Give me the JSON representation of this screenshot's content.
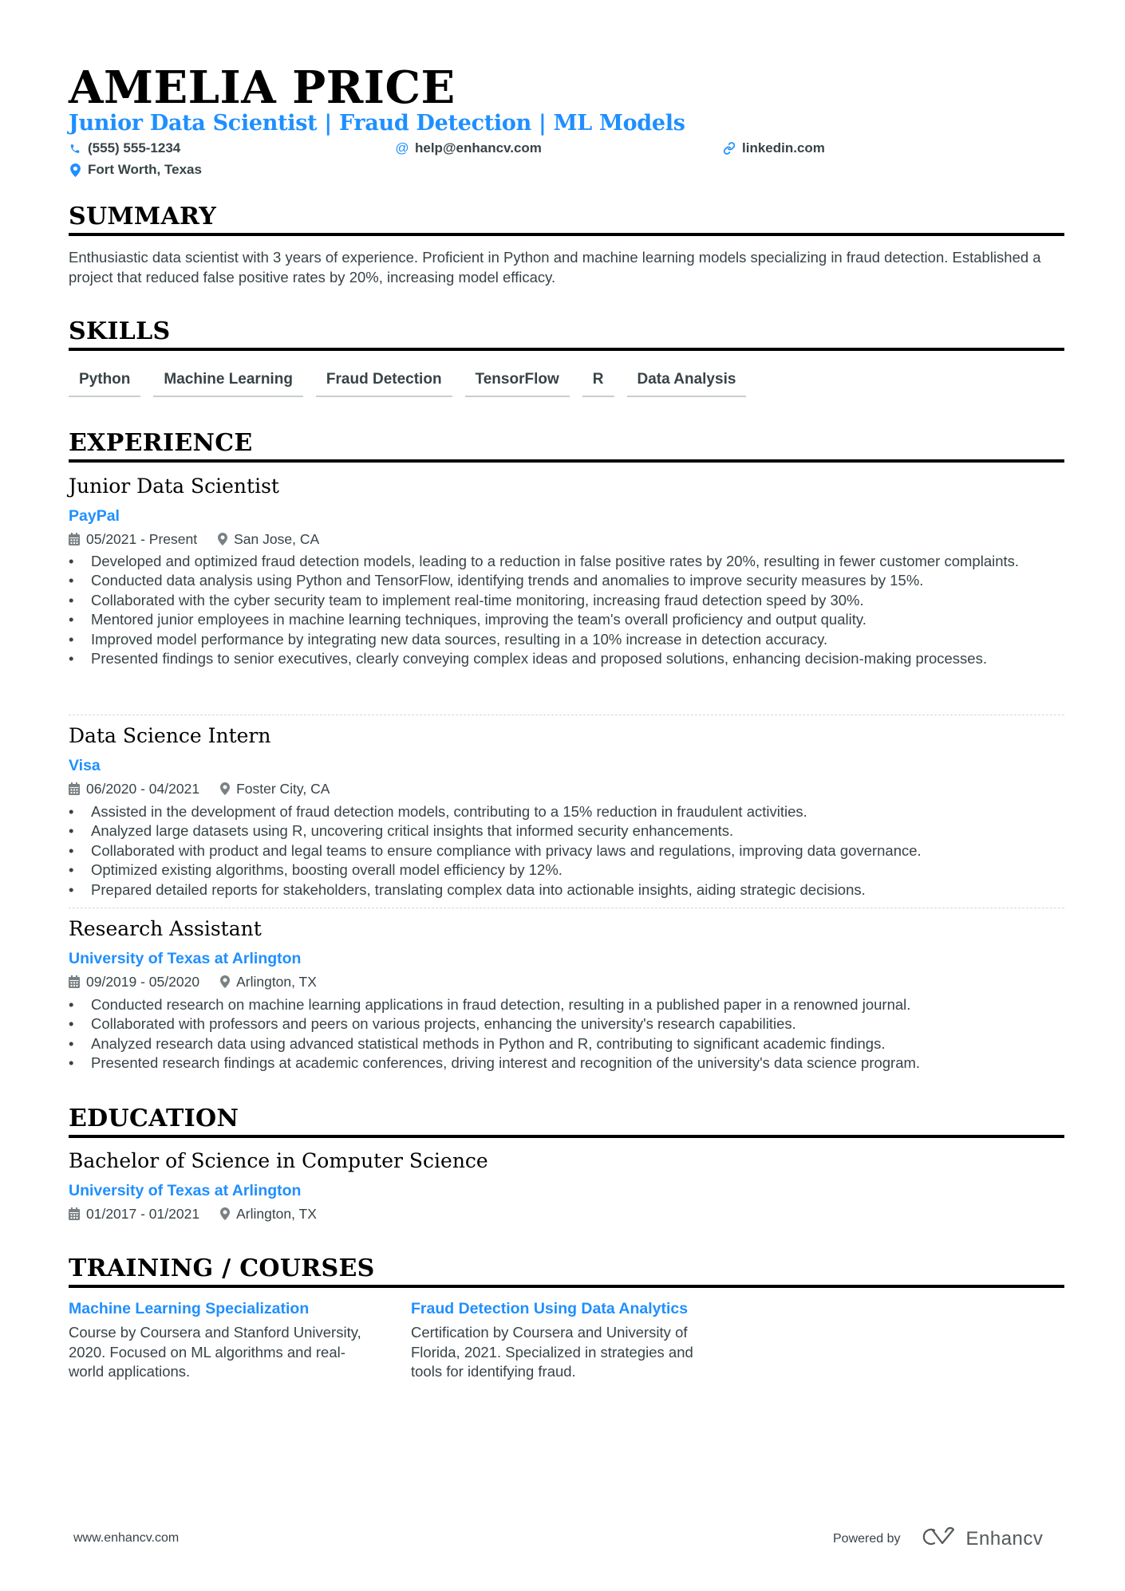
{
  "header": {
    "name": "AMELIA PRICE",
    "headline": "Junior Data Scientist | Fraud Detection | ML Models",
    "contacts": {
      "phone": "(555) 555-1234",
      "email": "help@enhancv.com",
      "link": "linkedin.com",
      "location": "Fort Worth, Texas"
    }
  },
  "summary": {
    "title": "SUMMARY",
    "text": "Enthusiastic data scientist with 3 years of experience. Proficient in Python and machine learning models specializing in fraud detection. Established a project that reduced false positive rates by 20%, increasing model efficacy."
  },
  "skills": {
    "title": "SKILLS",
    "items": [
      "Python",
      "Machine Learning",
      "Fraud Detection",
      "TensorFlow",
      "R",
      "Data Analysis"
    ]
  },
  "experience": {
    "title": "EXPERIENCE",
    "jobs": [
      {
        "title": "Junior Data Scientist",
        "company": "PayPal",
        "dates": "05/2021 - Present",
        "location": "San Jose, CA",
        "bullets": [
          "Developed and optimized fraud detection models, leading to a reduction in false positive rates by 20%, resulting in fewer customer complaints.",
          "Conducted data analysis using Python and TensorFlow, identifying trends and anomalies to improve security measures by 15%.",
          "Collaborated with the cyber security team to implement real-time monitoring, increasing fraud detection speed by 30%.",
          "Mentored junior employees in machine learning techniques, improving the team's overall proficiency and output quality.",
          "Improved model performance by integrating new data sources, resulting in a 10% increase in detection accuracy.",
          "Presented findings to senior executives, clearly conveying complex ideas and proposed solutions, enhancing decision-making processes."
        ]
      },
      {
        "title": "Data Science Intern",
        "company": "Visa",
        "dates": "06/2020 - 04/2021",
        "location": "Foster City, CA",
        "bullets": [
          "Assisted in the development of fraud detection models, contributing to a 15% reduction in fraudulent activities.",
          "Analyzed large datasets using R, uncovering critical insights that informed security enhancements.",
          "Collaborated with product and legal teams to ensure compliance with privacy laws and regulations, improving data governance.",
          "Optimized existing algorithms, boosting overall model efficiency by 12%.",
          "Prepared detailed reports for stakeholders, translating complex data into actionable insights, aiding strategic decisions."
        ]
      },
      {
        "title": "Research Assistant",
        "company": "University of Texas at Arlington",
        "dates": "09/2019 - 05/2020",
        "location": "Arlington, TX",
        "bullets": [
          "Conducted research on machine learning applications in fraud detection, resulting in a published paper in a renowned journal.",
          "Collaborated with professors and peers on various projects, enhancing the university's research capabilities.",
          "Analyzed research data using advanced statistical methods in Python and R, contributing to significant academic findings.",
          "Presented research findings at academic conferences, driving interest and recognition of the university's data science program."
        ]
      }
    ]
  },
  "education": {
    "title": "EDUCATION",
    "items": [
      {
        "degree": "Bachelor of Science in Computer Science",
        "school": "University of Texas at Arlington",
        "dates": "01/2017 - 01/2021",
        "location": "Arlington, TX"
      }
    ]
  },
  "training": {
    "title": "TRAINING / COURSES",
    "items": [
      {
        "title": "Machine Learning Specialization",
        "description": "Course by Coursera and Stanford University, 2020. Focused on ML algorithms and real-world applications."
      },
      {
        "title": "Fraud Detection Using Data Analytics",
        "description": "Certification by Coursera and University of Florida, 2021. Specialized in strategies and tools for identifying fraud."
      }
    ]
  },
  "footer": {
    "website": "www.enhancv.com",
    "powered_by": "Powered by",
    "brand": "Enhancv"
  },
  "colors": {
    "accent": "#1f8fff",
    "text": "#384347",
    "heading": "#000000"
  }
}
